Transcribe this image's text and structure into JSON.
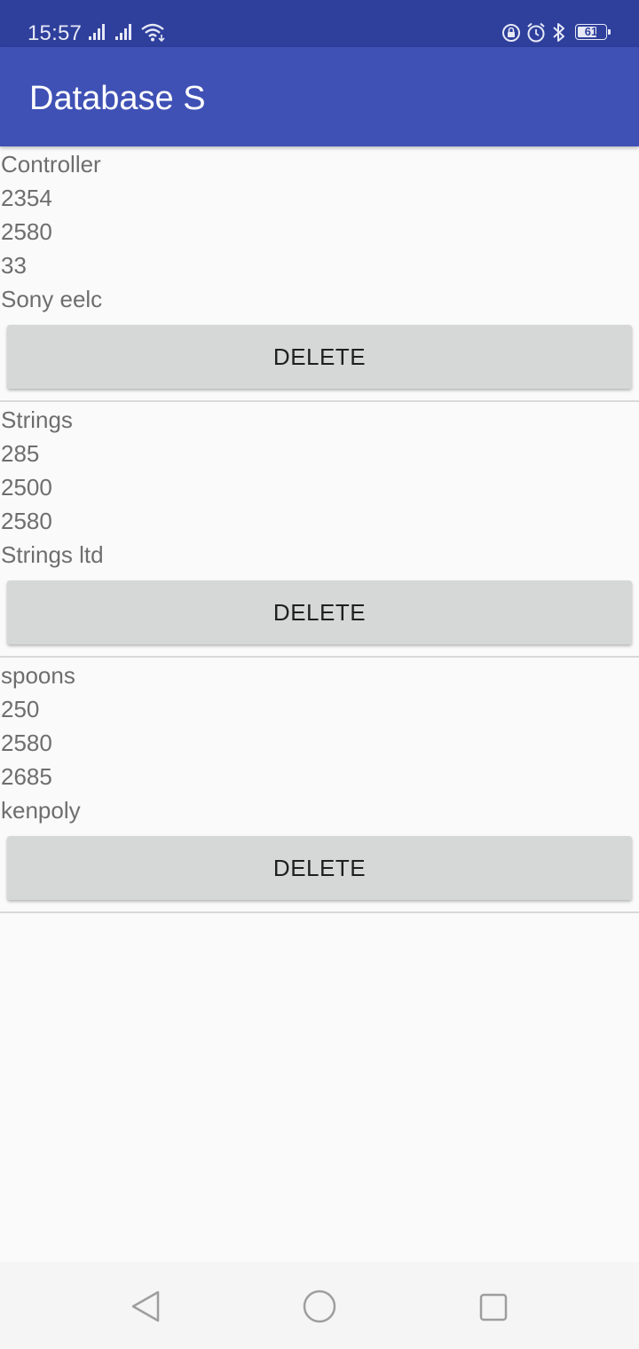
{
  "status_bar": {
    "time": "15:57",
    "battery_level": "61",
    "icons": [
      "cellular-signal-icon",
      "cellular-signal-icon",
      "wifi-icon",
      "rotation-lock-icon",
      "alarm-icon",
      "bluetooth-icon",
      "battery-icon"
    ]
  },
  "app_bar": {
    "title": "Database S",
    "color": "#3f51b5"
  },
  "records": [
    {
      "name": "Controller",
      "value1": "2354",
      "value2": "2580",
      "value3": "33",
      "supplier": "Sony eelc",
      "delete_label": "DELETE"
    },
    {
      "name": "Strings",
      "value1": "285",
      "value2": "2500",
      "value3": "2580",
      "supplier": "Strings ltd",
      "delete_label": "DELETE"
    },
    {
      "name": "spoons",
      "value1": "250",
      "value2": "2580",
      "value3": "2685",
      "supplier": "kenpoly",
      "delete_label": "DELETE"
    }
  ],
  "nav_bar": {
    "icons": [
      "back-icon",
      "home-icon",
      "recents-icon"
    ]
  }
}
